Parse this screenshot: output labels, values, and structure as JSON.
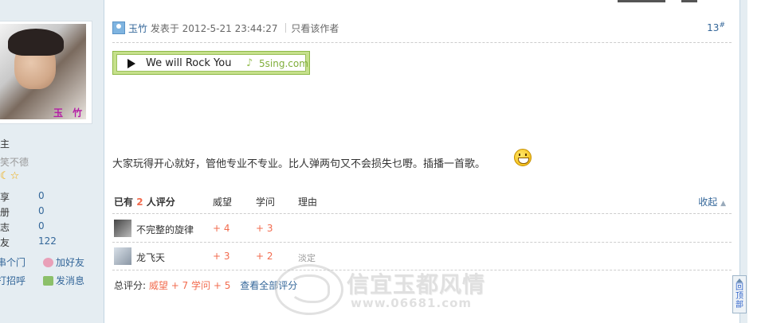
{
  "sidebar": {
    "avatar_name": "玉 竹",
    "rank_title": "主",
    "signature": "笑不德",
    "stars": "☾☆",
    "stats": [
      {
        "label": "享",
        "value": "0"
      },
      {
        "label": "册",
        "value": "0"
      },
      {
        "label": "志",
        "value": "0"
      },
      {
        "label": "友",
        "value": "122"
      }
    ],
    "links": {
      "visit": "串个门",
      "add_friend": "加好友",
      "greet": "打招呼",
      "message": "发消息"
    }
  },
  "post": {
    "author": "玉竹",
    "posted_at": "发表于 2012-5-21 23:44:27",
    "only_author": "只看该作者",
    "floor": "13",
    "floor_sup": "#",
    "player": {
      "song": "We will Rock You",
      "brand": "5sing.com"
    },
    "message": "大家玩得开心就好，管他专业不专业。比人弹两句又不会损失乜嘢。插播一首歌。"
  },
  "rating": {
    "prefix": "已有",
    "count": "2",
    "suffix": "人评分",
    "columns": [
      "威望",
      "学问",
      "理由"
    ],
    "collapse": "收起",
    "rows": [
      {
        "user": "不完整的旋律",
        "weiwang": "+ 4",
        "xuewen": "+ 3",
        "reason": ""
      },
      {
        "user": "龙飞天",
        "weiwang": "+ 3",
        "xuewen": "+ 2",
        "reason": "淡定"
      }
    ],
    "total_label": "总评分:",
    "total_weiwang": "威望 + 7",
    "total_xuewen": "学问 + 5",
    "view_all": "查看全部评分"
  },
  "watermark": {
    "text": "信宜玉都风情",
    "url": "www.06681.com"
  },
  "back_to_top": "回顶部"
}
